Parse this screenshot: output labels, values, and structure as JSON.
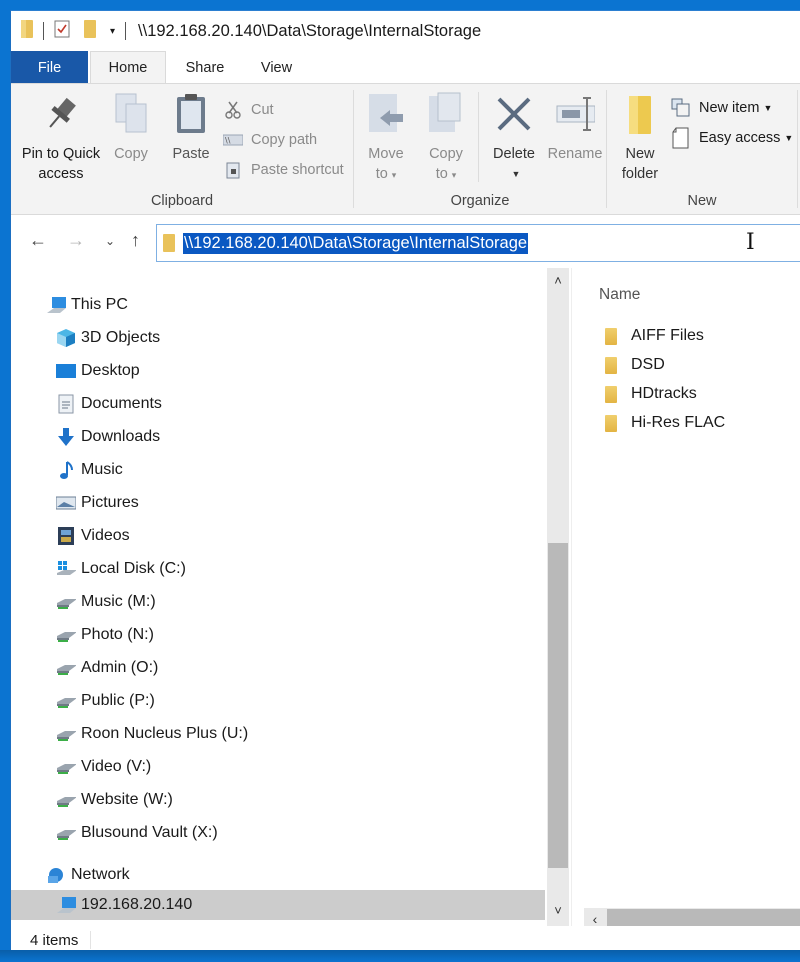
{
  "window": {
    "title": "\\\\192.168.20.140\\Data\\Storage\\InternalStorage",
    "quick_access_icons": [
      "folder-icon",
      "properties-icon",
      "new-folder-icon",
      "customize-dropdown-icon"
    ]
  },
  "tabs": [
    {
      "label": "File",
      "active": false
    },
    {
      "label": "Home",
      "active": true
    },
    {
      "label": "Share",
      "active": false
    },
    {
      "label": "View",
      "active": false
    }
  ],
  "ribbon": {
    "clipboard": {
      "label": "Clipboard",
      "pin": "Pin to Quick access",
      "pin_line1": "Pin to Quick",
      "pin_line2": "access",
      "copy": "Copy",
      "paste": "Paste",
      "cut": "Cut",
      "copy_path": "Copy path",
      "paste_shortcut": "Paste shortcut"
    },
    "organize": {
      "label": "Organize",
      "move_line1": "Move",
      "move_line2": "to",
      "copy_line1": "Copy",
      "copy_line2": "to",
      "delete": "Delete",
      "rename": "Rename"
    },
    "new": {
      "label": "New",
      "new_folder_line1": "New",
      "new_folder_line2": "folder",
      "new_item": "New item",
      "easy_access": "Easy access"
    }
  },
  "address_bar": {
    "value": "\\\\192.168.20.140\\Data\\Storage\\InternalStorage",
    "selected": true
  },
  "nav_pane": {
    "this_pc": "This PC",
    "items": [
      {
        "label": "3D Objects",
        "icon": "3d-objects-icon"
      },
      {
        "label": "Desktop",
        "icon": "desktop-icon"
      },
      {
        "label": "Documents",
        "icon": "documents-icon"
      },
      {
        "label": "Downloads",
        "icon": "downloads-icon"
      },
      {
        "label": "Music",
        "icon": "music-icon"
      },
      {
        "label": "Pictures",
        "icon": "pictures-icon"
      },
      {
        "label": "Videos",
        "icon": "videos-icon"
      },
      {
        "label": "Local Disk (C:)",
        "icon": "local-disk-icon"
      },
      {
        "label": "Music (M:)",
        "icon": "network-drive-icon"
      },
      {
        "label": "Photo (N:)",
        "icon": "network-drive-icon"
      },
      {
        "label": "Admin (O:)",
        "icon": "network-drive-icon"
      },
      {
        "label": "Public (P:)",
        "icon": "network-drive-icon"
      },
      {
        "label": "Roon Nucleus Plus (U:)",
        "icon": "network-drive-icon"
      },
      {
        "label": "Video (V:)",
        "icon": "network-drive-icon"
      },
      {
        "label": "Website (W:)",
        "icon": "network-drive-icon"
      },
      {
        "label": "Blusound Vault (X:)",
        "icon": "network-drive-icon"
      }
    ],
    "network": "Network",
    "network_host": "192.168.20.140",
    "scroll_position_fraction": 0.75
  },
  "content": {
    "column_header": "Name",
    "files": [
      {
        "name": "AIFF Files",
        "type": "folder"
      },
      {
        "name": "DSD",
        "type": "folder"
      },
      {
        "name": "HDtracks",
        "type": "folder"
      },
      {
        "name": "Hi-Res FLAC",
        "type": "folder"
      }
    ]
  },
  "status": {
    "item_count": "4 items"
  },
  "colors": {
    "accent": "#1958a8",
    "selection": "#0a58c2",
    "desktop": "#0b74d1",
    "folder": "#e9c25a"
  }
}
